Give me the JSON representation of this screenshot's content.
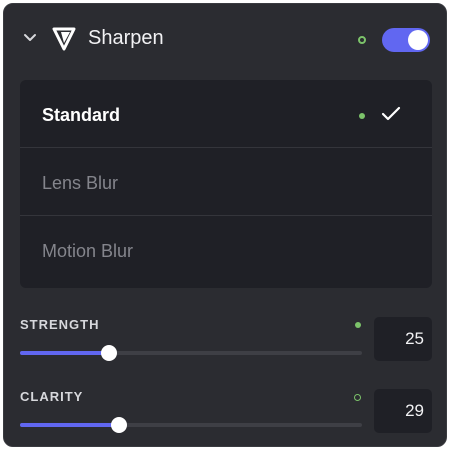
{
  "header": {
    "title": "Sharpen",
    "collapse_icon": "chevron-down-icon",
    "logo_icon": "triangle-logo-icon",
    "enabled": true,
    "accent_color": "#6167f1",
    "status_color": "#7cc36a"
  },
  "options": [
    {
      "label": "Standard",
      "selected": true
    },
    {
      "label": "Lens Blur",
      "selected": false
    },
    {
      "label": "Motion Blur",
      "selected": false
    }
  ],
  "sliders": {
    "strength": {
      "label": "STRENGTH",
      "value": "25",
      "fraction": 0.26
    },
    "clarity": {
      "label": "CLARITY",
      "value": "29",
      "fraction": 0.29
    }
  }
}
